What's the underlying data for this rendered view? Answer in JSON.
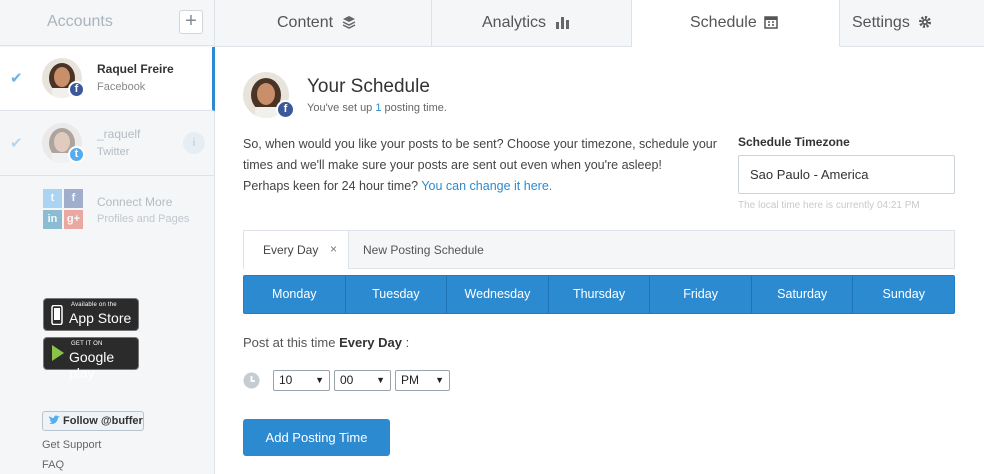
{
  "sidebar": {
    "title": "Accounts",
    "add_symbol": "+",
    "accounts": [
      {
        "name": "Raquel Freire",
        "network": "Facebook",
        "badge": "f"
      },
      {
        "name": "_raquelf",
        "network": "Twitter",
        "badge": "t"
      }
    ],
    "connect": {
      "line1": "Connect More",
      "line2": "Profiles and Pages"
    },
    "app_store": {
      "small": "Available on the",
      "big": "App Store"
    },
    "google_play": {
      "small": "GET IT ON",
      "big": "Google play"
    },
    "follow": "Follow @buffer",
    "links": [
      "Get Support",
      "FAQ"
    ]
  },
  "tabs": [
    {
      "label": "Content",
      "icon": "layers-icon"
    },
    {
      "label": "Analytics",
      "icon": "bar-chart-icon"
    },
    {
      "label": "Schedule",
      "icon": "calendar-icon"
    },
    {
      "label": "Settings",
      "icon": "gear-icon"
    }
  ],
  "main": {
    "title": "Your Schedule",
    "subtitle_pre": "You've set up ",
    "subtitle_num": "1",
    "subtitle_post": " posting time.",
    "intro_text": "So, when would you like your posts to be sent? Choose your timezone, schedule your times and we'll make sure your posts are sent out even when you're asleep!",
    "intro_question": "Perhaps keen for 24 hour time?",
    "intro_link": "You can change it here.",
    "timezone_label": "Schedule Timezone",
    "timezone_value": "Sao Paulo - America",
    "timezone_hint": "The local time here is currently 04:21 PM",
    "schedule_tab": "Every Day",
    "schedule_tab_close": "×",
    "new_schedule": "New Posting Schedule",
    "days": [
      "Monday",
      "Tuesday",
      "Wednesday",
      "Thursday",
      "Friday",
      "Saturday",
      "Sunday"
    ],
    "post_at_label": "Post at this time",
    "post_at_value": "Every Day",
    "post_at_colon": ":",
    "hour": "10",
    "minute": "00",
    "ampm": "PM",
    "add_button": "Add Posting Time"
  },
  "colors": {
    "accent": "#2c8ad1",
    "facebook": "#3b5998",
    "twitter": "#55acee"
  }
}
